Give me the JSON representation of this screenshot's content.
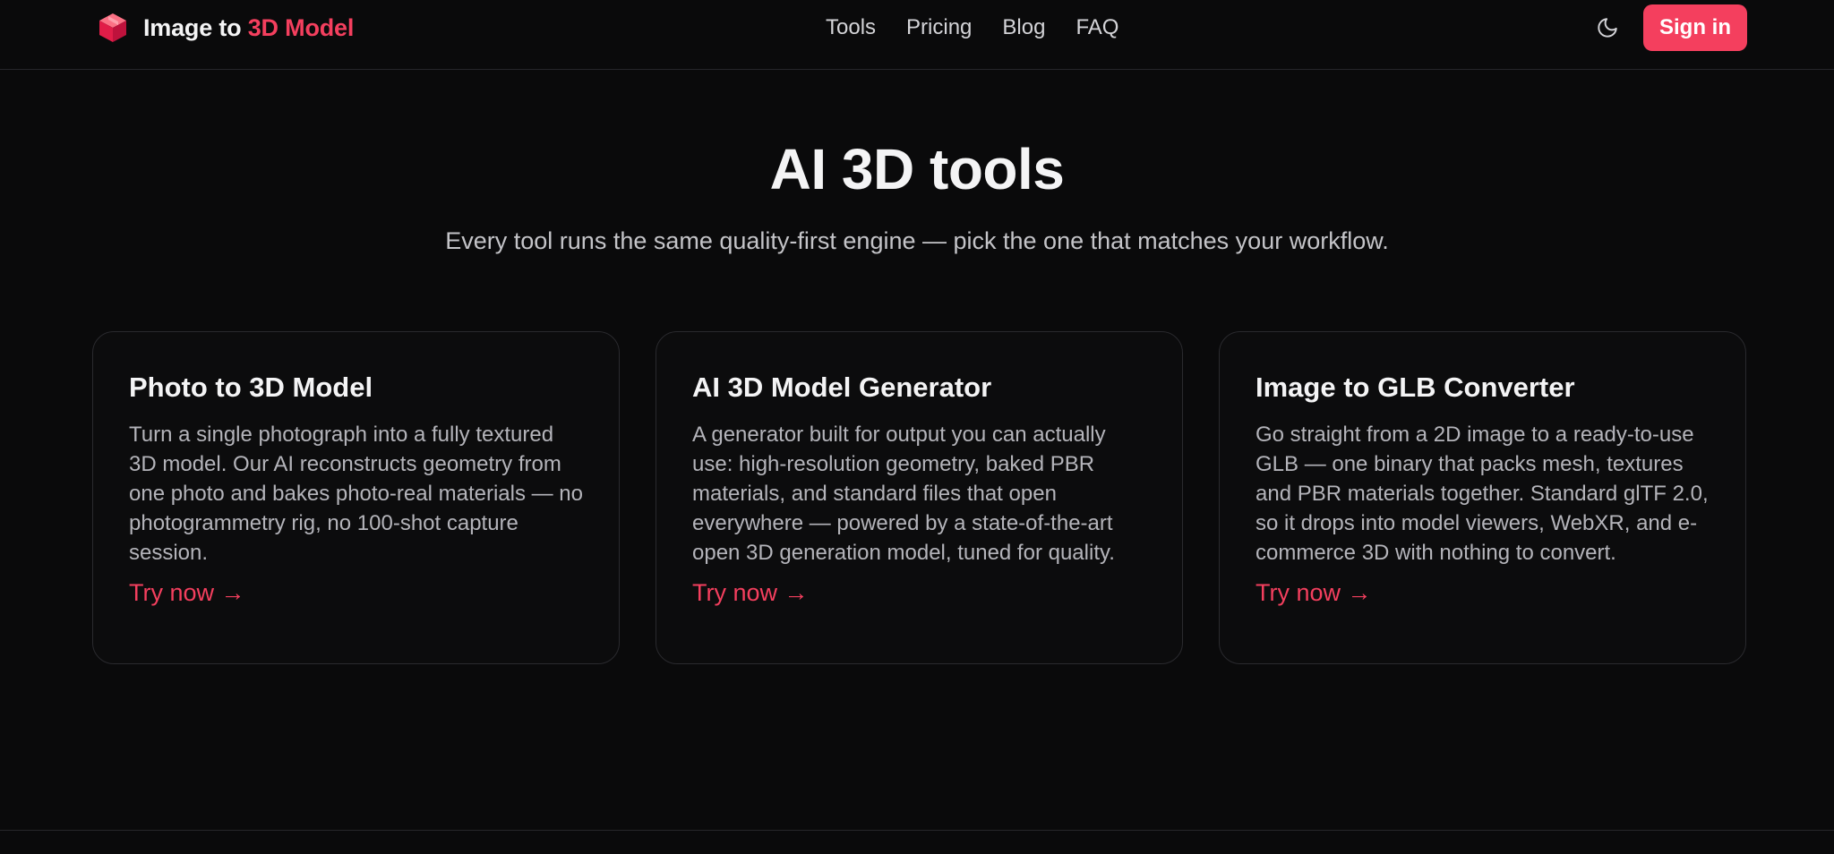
{
  "brand": {
    "name_prefix": "Image to",
    "name_accent": "3D Model",
    "icon": "cube-icon",
    "accent_color": "#f43f5e"
  },
  "nav": {
    "items": [
      "Tools",
      "Pricing",
      "Blog",
      "FAQ"
    ]
  },
  "header": {
    "theme_toggle_icon": "moon-icon",
    "signin_label": "Sign in"
  },
  "hero": {
    "title": "AI 3D tools",
    "subtitle": "Every tool runs the same quality-first engine — pick the one that matches your workflow."
  },
  "cards": [
    {
      "title": "Photo to 3D Model",
      "description": "Turn a single photograph into a fully textured 3D model. Our AI reconstructs geometry from one photo and bakes photo-real materials — no photogrammetry rig, no 100-shot capture session.",
      "link": "Try now →"
    },
    {
      "title": "AI 3D Model Generator",
      "description": "A generator built for output you can actually use: high-resolution geometry, baked PBR materials, and standard files that open everywhere — powered by a state-of-the-art open 3D generation model, tuned for quality.",
      "link": "Try now →"
    },
    {
      "title": "Image to GLB Converter",
      "description": "Go straight from a 2D image to a ready-to-use GLB — one binary that packs mesh, textures and PBR materials together. Standard glTF 2.0, so it drops into model viewers, WebXR, and e-commerce 3D with nothing to convert.",
      "link": "Try now →"
    }
  ]
}
